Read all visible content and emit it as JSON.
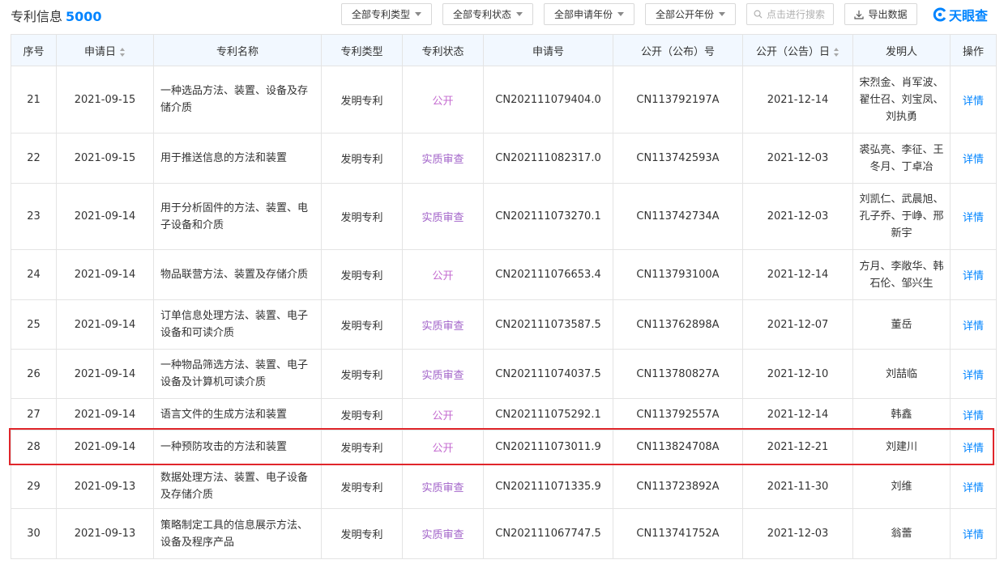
{
  "header": {
    "title": "专利信息",
    "count": "5000",
    "filters": [
      {
        "label": "全部专利类型"
      },
      {
        "label": "全部专利状态"
      },
      {
        "label": "全部申请年份"
      },
      {
        "label": "全部公开年份"
      }
    ],
    "search_placeholder": "点击进行搜索",
    "export_label": "导出数据",
    "logo_text": "天眼查"
  },
  "colors": {
    "accent": "#0084ff",
    "header_bg": "#f2f8ff",
    "status_purple": "#a263c9",
    "highlight": "#e0262b"
  },
  "table": {
    "columns": [
      "序号",
      "申请日",
      "专利名称",
      "专利类型",
      "专利状态",
      "申请号",
      "公开（公布）号",
      "公开（公告）日",
      "发明人",
      "操作"
    ],
    "rows": [
      {
        "no": "21",
        "date": "2021-09-15",
        "name": "一种选品方法、装置、设备及存储介质",
        "type": "发明专利",
        "status": "公开",
        "app_no": "CN202111079404.0",
        "pub_no": "CN113792197A",
        "pub_date": "2021-12-14",
        "inventors": "宋烈金、肖军波、翟仕召、刘宝凤、刘执勇",
        "action": "详情"
      },
      {
        "no": "22",
        "date": "2021-09-15",
        "name": "用于推送信息的方法和装置",
        "type": "发明专利",
        "status": "实质审查",
        "app_no": "CN202111082317.0",
        "pub_no": "CN113742593A",
        "pub_date": "2021-12-03",
        "inventors": "裘弘亮、李征、王冬月、丁卓冶",
        "action": "详情"
      },
      {
        "no": "23",
        "date": "2021-09-14",
        "name": "用于分析固件的方法、装置、电子设备和介质",
        "type": "发明专利",
        "status": "实质审查",
        "app_no": "CN202111073270.1",
        "pub_no": "CN113742734A",
        "pub_date": "2021-12-03",
        "inventors": "刘凯仁、武晨旭、孔子乔、于峥、邢新宇",
        "action": "详情"
      },
      {
        "no": "24",
        "date": "2021-09-14",
        "name": "物品联营方法、装置及存储介质",
        "type": "发明专利",
        "status": "公开",
        "app_no": "CN202111076653.4",
        "pub_no": "CN113793100A",
        "pub_date": "2021-12-14",
        "inventors": "方月、李敞华、韩石伦、邹兴生",
        "action": "详情"
      },
      {
        "no": "25",
        "date": "2021-09-14",
        "name": "订单信息处理方法、装置、电子设备和可读介质",
        "type": "发明专利",
        "status": "实质审查",
        "app_no": "CN202111073587.5",
        "pub_no": "CN113762898A",
        "pub_date": "2021-12-07",
        "inventors": "董岳",
        "action": "详情"
      },
      {
        "no": "26",
        "date": "2021-09-14",
        "name": "一种物品筛选方法、装置、电子设备及计算机可读介质",
        "type": "发明专利",
        "status": "实质审查",
        "app_no": "CN202111074037.5",
        "pub_no": "CN113780827A",
        "pub_date": "2021-12-10",
        "inventors": "刘喆临",
        "action": "详情"
      },
      {
        "no": "27",
        "date": "2021-09-14",
        "name": "语言文件的生成方法和装置",
        "type": "发明专利",
        "status": "公开",
        "app_no": "CN202111075292.1",
        "pub_no": "CN113792557A",
        "pub_date": "2021-12-14",
        "inventors": "韩鑫",
        "action": "详情"
      },
      {
        "no": "28",
        "date": "2021-09-14",
        "name": "一种预防攻击的方法和装置",
        "type": "发明专利",
        "status": "公开",
        "app_no": "CN202111073011.9",
        "pub_no": "CN113824708A",
        "pub_date": "2021-12-21",
        "inventors": "刘建川",
        "action": "详情"
      },
      {
        "no": "29",
        "date": "2021-09-13",
        "name": "数据处理方法、装置、电子设备及存储介质",
        "type": "发明专利",
        "status": "实质审查",
        "app_no": "CN202111071335.9",
        "pub_no": "CN113723892A",
        "pub_date": "2021-11-30",
        "inventors": "刘维",
        "action": "详情"
      },
      {
        "no": "30",
        "date": "2021-09-13",
        "name": "策略制定工具的信息展示方法、设备及程序产品",
        "type": "发明专利",
        "status": "实质审查",
        "app_no": "CN202111067747.5",
        "pub_no": "CN113741752A",
        "pub_date": "2021-12-03",
        "inventors": "翁蕾",
        "action": "详情"
      }
    ]
  }
}
